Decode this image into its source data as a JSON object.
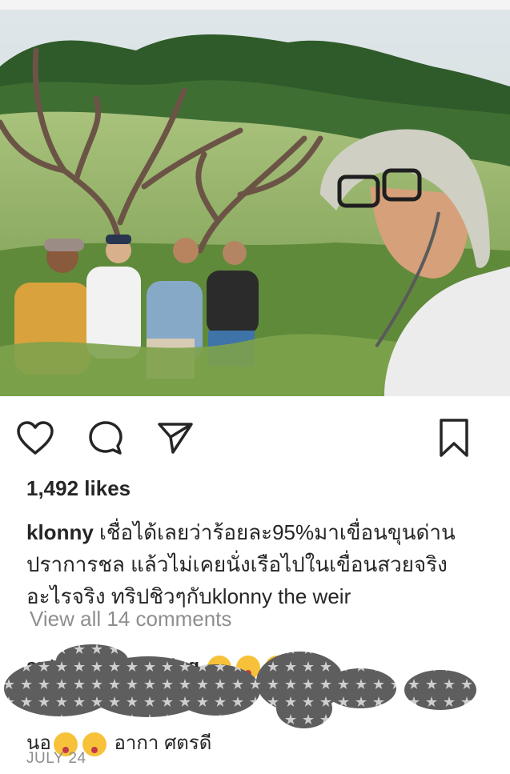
{
  "post": {
    "likes": "1,492 likes",
    "caption_user": "klonny",
    "caption_text": " เชื่อได้เลยว่าร้อยละ95%มาเขื่อนขุนด่านปราการชล แล้วไม่เคยนั่งเรือไปในเขื่อนสวยจริงอะไรจริง ทริปชิวๆกับklonny the weir",
    "view_all": "View all 14 comments",
    "comment_user": "sutanp_wannasing",
    "comment_text": "นอ",
    "comment_tail": "อากา ศตรดี",
    "date": "JULY 24"
  },
  "icons": {
    "like": "heart-icon",
    "comment": "comment-bubble-icon",
    "share": "paper-plane-icon",
    "save": "bookmark-icon"
  },
  "colors": {
    "text": "#262626",
    "muted": "#8e8e8e",
    "background": "#ffffff"
  }
}
